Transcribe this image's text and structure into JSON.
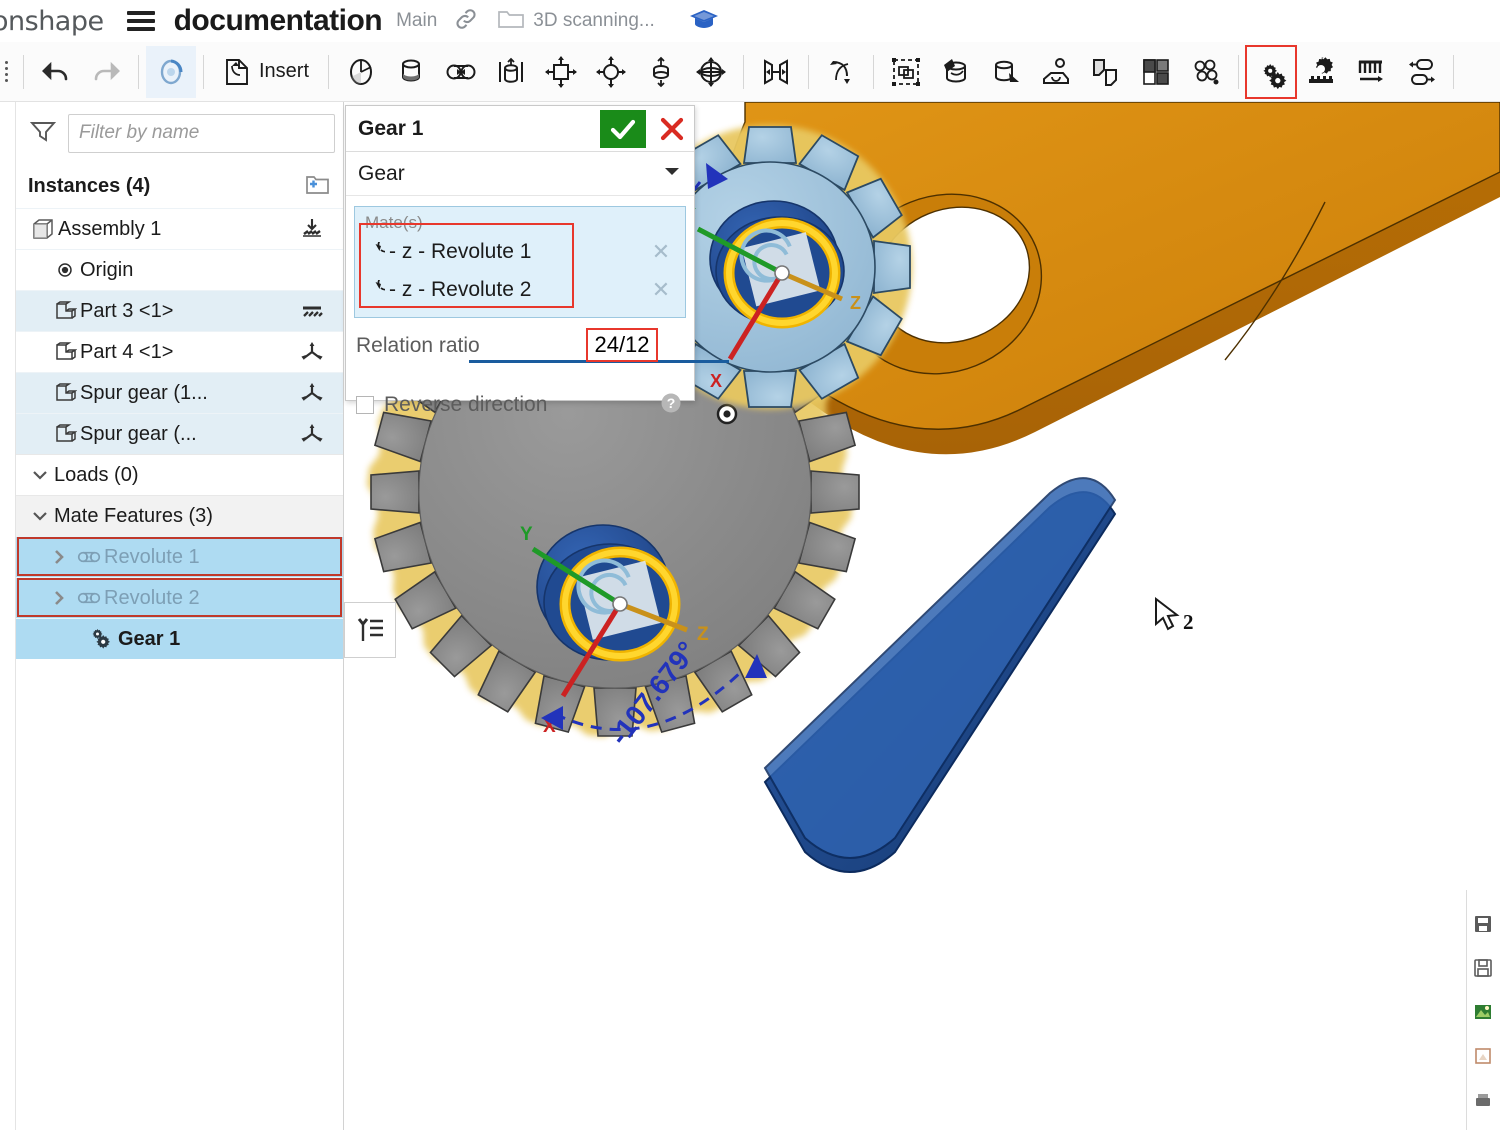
{
  "titlebar": {
    "logo": "onshape",
    "menu_icon": "hamburger-icon",
    "document_title": "documentation",
    "branch": "Main",
    "link_icon": "link-icon",
    "folder_icon": "folder-icon",
    "folder_label": "3D scanning...",
    "learning_icon": "graduation-cap-icon"
  },
  "toolbar": {
    "items": [
      {
        "name": "undo-button",
        "icon": "undo-arrow-icon",
        "label": ""
      },
      {
        "name": "redo-button",
        "icon": "redo-arrow-icon",
        "label": ""
      },
      {
        "name": "rebuild-button",
        "icon": "rebuild-circle-icon",
        "label": ""
      },
      {
        "name": "insert-button",
        "icon": "insert-part-icon",
        "label": "Insert"
      },
      {
        "name": "mate-connector-button",
        "icon": "mate-connector-icon",
        "label": ""
      },
      {
        "name": "fastened-mate-button",
        "icon": "fastened-mate-icon",
        "label": ""
      },
      {
        "name": "revolute-mate-button",
        "icon": "revolute-mate-icon",
        "label": ""
      },
      {
        "name": "slider-mate-button",
        "icon": "slider-mate-icon",
        "label": ""
      },
      {
        "name": "planar-mate-button",
        "icon": "planar-mate-icon",
        "label": ""
      },
      {
        "name": "cylindrical-mate-button",
        "icon": "cylindrical-mate-icon",
        "label": ""
      },
      {
        "name": "pin-slot-mate-button",
        "icon": "pin-slot-mate-icon",
        "label": ""
      },
      {
        "name": "ball-mate-button",
        "icon": "ball-mate-icon",
        "label": ""
      },
      {
        "name": "parallel-mate-button",
        "icon": "parallel-mate-icon",
        "label": ""
      },
      {
        "name": "tangent-mate-button",
        "icon": "tangent-mate-icon",
        "label": ""
      },
      {
        "name": "group-button",
        "icon": "group-icon",
        "label": ""
      },
      {
        "name": "replace-instance-button",
        "icon": "replace-instance-icon",
        "label": ""
      },
      {
        "name": "transform-button",
        "icon": "transform-instance-icon",
        "label": ""
      },
      {
        "name": "assembly-feature-button",
        "icon": "assembly-feature-icon",
        "label": ""
      },
      {
        "name": "copy-mate-button",
        "icon": "copy-mate-icon",
        "label": ""
      },
      {
        "name": "explode-button",
        "icon": "explode-view-icon",
        "label": ""
      },
      {
        "name": "bom-button",
        "icon": "bom-icon",
        "label": ""
      },
      {
        "name": "gear-relation-button",
        "icon": "gear-relation-icon",
        "label": ""
      },
      {
        "name": "rack-pinion-relation-button",
        "icon": "rack-pinion-icon",
        "label": ""
      },
      {
        "name": "screw-relation-button",
        "icon": "screw-relation-icon",
        "label": ""
      },
      {
        "name": "linear-relation-button",
        "icon": "linear-relation-icon",
        "label": ""
      }
    ],
    "highlighted": "gear-relation-button"
  },
  "sidebar": {
    "filter_icon": "funnel-filter-icon",
    "filter_placeholder": "Filter by name",
    "list_view_icon": "list-view-icon",
    "instances_header": "Instances (4)",
    "add_folder_icon": "add-folder-icon",
    "instances": [
      {
        "label": "Assembly 1",
        "icon": "assembly-icon",
        "right_icon": "fix-ground-icon",
        "indent": 0,
        "state": "normal"
      },
      {
        "label": "Origin",
        "icon": "origin-icon",
        "right_icon": "",
        "indent": 1,
        "state": "normal"
      },
      {
        "label": "Part 3 <1>",
        "icon": "part-icon",
        "right_icon": "ground-hatch-icon",
        "indent": 1,
        "state": "selected"
      },
      {
        "label": "Part 4 <1>",
        "icon": "part-icon",
        "right_icon": "free-triad-icon",
        "indent": 1,
        "state": "normal"
      },
      {
        "label": "Spur gear (1...",
        "icon": "part-icon",
        "right_icon": "free-triad-icon",
        "indent": 1,
        "state": "selected"
      },
      {
        "label": "Spur gear (...",
        "icon": "part-icon",
        "right_icon": "free-triad-icon",
        "indent": 1,
        "state": "selected"
      }
    ],
    "loads_header": "Loads (0)",
    "mate_features_header": "Mate Features (3)",
    "mate_features": [
      {
        "label": "Revolute 1",
        "icon": "revolute-mate-icon",
        "chevron": "chevron-right-icon",
        "state": "selected-dim",
        "outline": true
      },
      {
        "label": "Revolute 2",
        "icon": "revolute-mate-icon",
        "chevron": "chevron-right-icon",
        "state": "selected-dim",
        "outline": true
      },
      {
        "label": "Gear 1",
        "icon": "gear-relation-icon",
        "chevron": "",
        "state": "selected-bold",
        "outline": false
      }
    ],
    "feature_list_toggle_icon": "feature-list-icon"
  },
  "dialog": {
    "title": "Gear 1",
    "confirm_icon": "checkmark-icon",
    "cancel_icon": "x-close-icon",
    "type_value": "Gear",
    "type_dropdown_icon": "chevron-down-icon",
    "mates_label": "Mate(s)",
    "mates": [
      {
        "icon": "rotation-arrow-icon",
        "label": "- z - Revolute 1",
        "remove_icon": "x-remove-icon"
      },
      {
        "icon": "rotation-arrow-icon",
        "label": "- z - Revolute 2",
        "remove_icon": "x-remove-icon"
      }
    ],
    "ratio_label": "Relation ratio",
    "ratio_value": "24/12",
    "reverse_label": "Reverse direction",
    "reverse_checked": false,
    "help_icon": "question-help-icon"
  },
  "viewport": {
    "cursor_icon": "mouse-pointer-icon",
    "cursor_badge": "2",
    "annotations": [
      {
        "name": "large-gear-angle",
        "text": "-107.679°"
      },
      {
        "name": "small-gear-angle",
        "text": "-107.679°"
      }
    ],
    "model": {
      "link_part_color": "#d4850f",
      "large_gear_color": "#8c8c8c",
      "large_gear_teeth": 24,
      "small_gear_color": "#9dc0d8",
      "small_gear_teeth": 12,
      "arm_color": "#1e4f9e",
      "highlight_edge_color": "#e8c860",
      "hub_ring_color": "#ffcf1f",
      "axis_x_color": "#cc2222",
      "axis_y_color": "#1f9a28",
      "axis_z_color": "#c9911a",
      "mate_arrow_color": "#2233bb"
    }
  },
  "right_toolbar": {
    "items": [
      {
        "name": "display-state-icon"
      },
      {
        "name": "save-view-icon"
      },
      {
        "name": "scene-appearance-icon"
      },
      {
        "name": "render-icon"
      },
      {
        "name": "section-view-icon"
      }
    ]
  }
}
